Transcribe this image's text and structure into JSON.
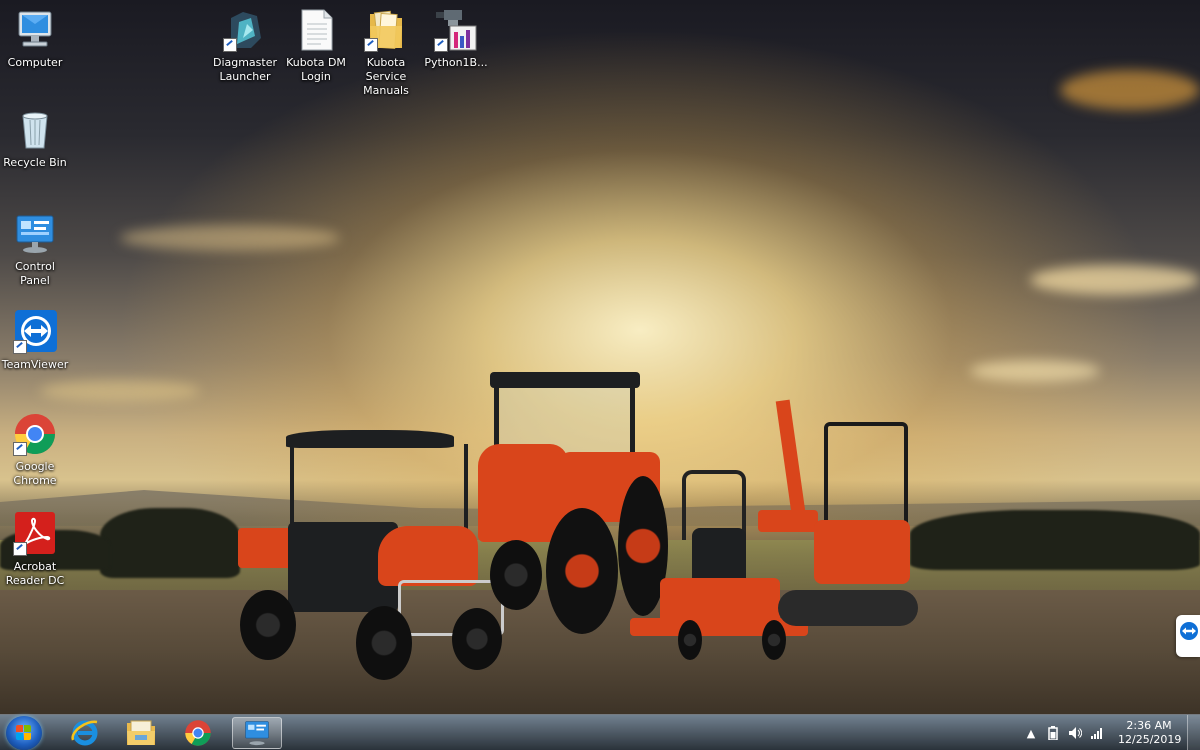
{
  "desktop_icons": [
    {
      "label": "Computer",
      "icon": "computer-icon"
    },
    {
      "label": "Recycle Bin",
      "icon": "recycle-bin-icon"
    },
    {
      "label": "Control Panel",
      "icon": "control-panel-icon"
    },
    {
      "label": "TeamViewer",
      "icon": "teamviewer-icon"
    },
    {
      "label": "Google Chrome",
      "icon": "chrome-icon"
    },
    {
      "label": "Acrobat Reader DC",
      "icon": "acrobat-icon"
    },
    {
      "label": "Diagmaster Launcher",
      "icon": "diagmaster-icon"
    },
    {
      "label": "Kubota DM Login",
      "icon": "text-file-icon"
    },
    {
      "label": "Kubota Service Manuals",
      "icon": "folder-icon"
    },
    {
      "label": "Python1B...",
      "icon": "python-app-icon"
    }
  ],
  "taskbar": {
    "pinned": [
      {
        "icon": "internet-explorer-icon"
      },
      {
        "icon": "file-explorer-icon"
      },
      {
        "icon": "chrome-icon"
      },
      {
        "icon": "control-panel-icon",
        "active": true
      }
    ],
    "tray": {
      "time": "2:36 AM",
      "date": "12/25/2019",
      "icons": [
        "show-hidden-icon",
        "battery-icon",
        "volume-icon",
        "network-icon"
      ]
    }
  },
  "wallpaper": {
    "colors": {
      "sky_top": "#1a1a22",
      "sun": "#fff4c8",
      "ground": "#574a39",
      "kubota_orange": "#d9451b"
    }
  }
}
